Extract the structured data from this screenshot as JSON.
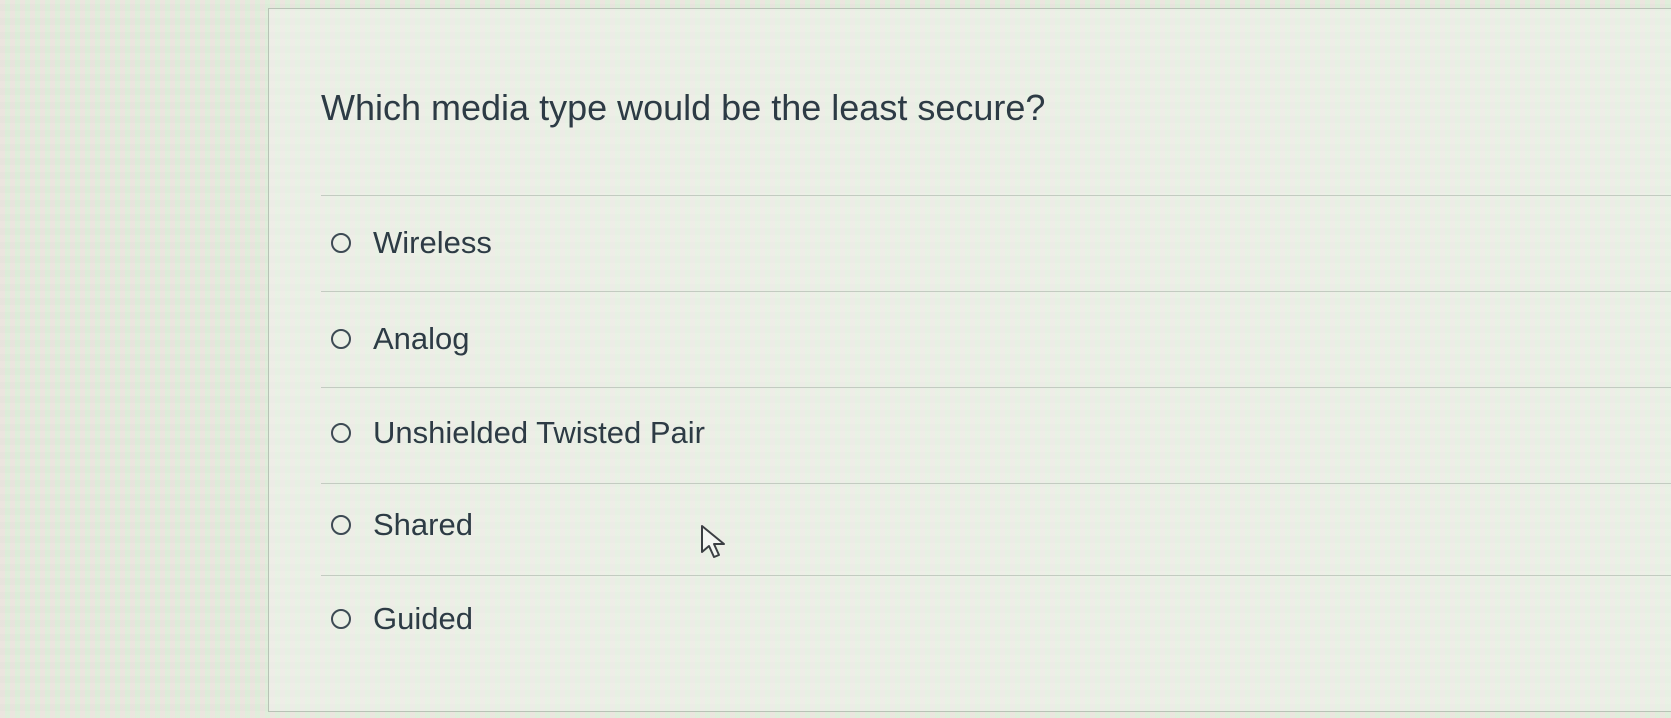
{
  "question": {
    "text": "Which media type would be the least secure?"
  },
  "answers": [
    {
      "label": "Wireless",
      "selected": false
    },
    {
      "label": "Analog",
      "selected": false
    },
    {
      "label": "Unshielded Twisted Pair",
      "selected": false
    },
    {
      "label": "Shared",
      "selected": false
    },
    {
      "label": "Guided",
      "selected": false
    }
  ],
  "icons": {
    "radio": "radio-circle-icon",
    "cursor": "mouse-pointer-icon"
  },
  "colors": {
    "text": "#2d3b45",
    "divider": "#c3cbc1",
    "radio_border": "#3d4a54"
  }
}
